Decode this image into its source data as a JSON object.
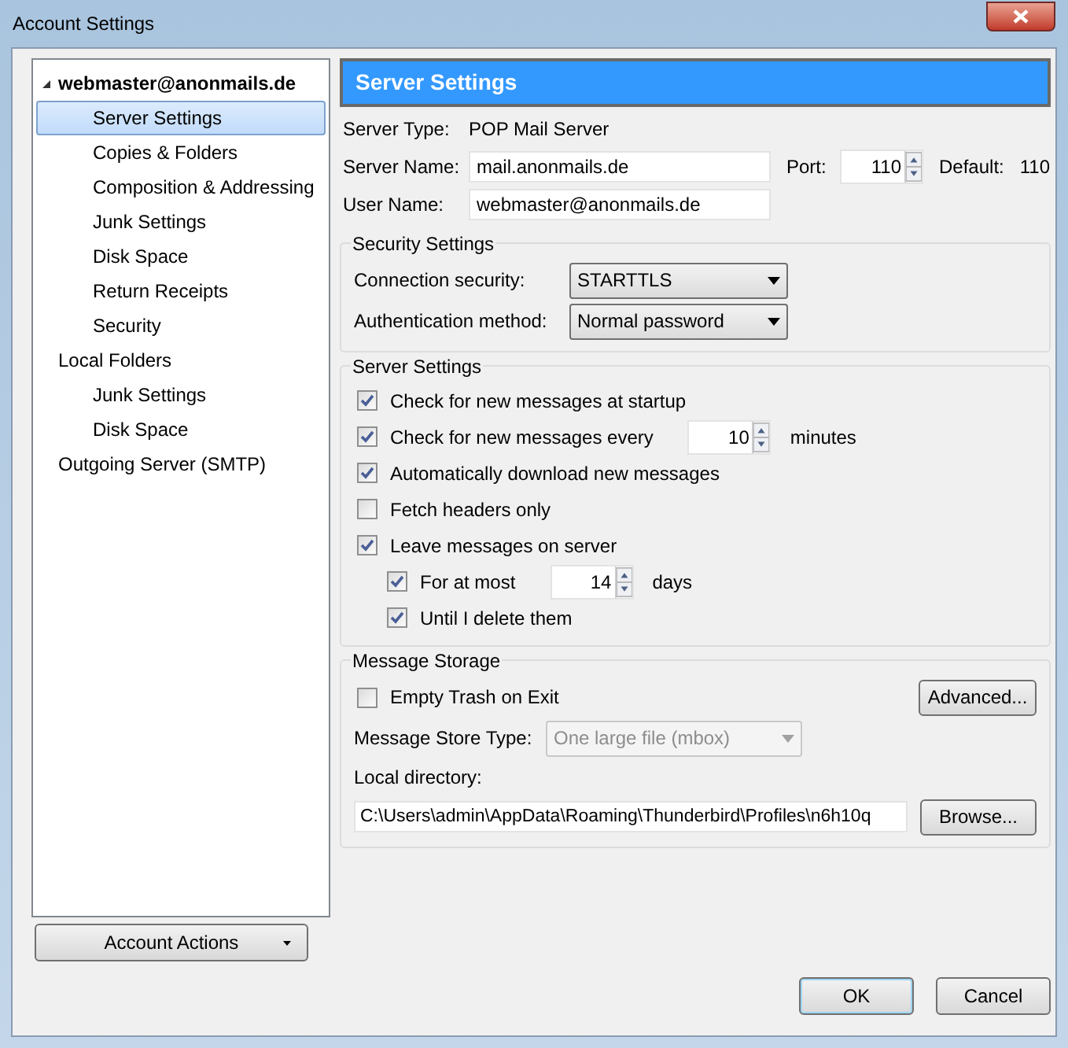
{
  "window": {
    "title": "Account Settings"
  },
  "tree": [
    {
      "label": "webmaster@anonmails.de",
      "selected": false,
      "expanded": true,
      "children": [
        {
          "label": "Server Settings",
          "selected": true
        },
        {
          "label": "Copies & Folders",
          "selected": false
        },
        {
          "label": "Composition & Addressing",
          "selected": false
        },
        {
          "label": "Junk Settings",
          "selected": false
        },
        {
          "label": "Disk Space",
          "selected": false
        },
        {
          "label": "Return Receipts",
          "selected": false
        },
        {
          "label": "Security",
          "selected": false
        }
      ]
    },
    {
      "label": "Local Folders",
      "selected": false,
      "children": [
        {
          "label": "Junk Settings",
          "selected": false
        },
        {
          "label": "Disk Space",
          "selected": false
        }
      ]
    },
    {
      "label": "Outgoing Server (SMTP)",
      "selected": false
    }
  ],
  "account_actions": "Account Actions",
  "header": "Server Settings",
  "server_type": {
    "label": "Server Type:",
    "value": "POP Mail Server"
  },
  "server_name": {
    "label": "Server Name:",
    "value": "mail.anonmails.de"
  },
  "port": {
    "label": "Port:",
    "value": "110"
  },
  "default_port": {
    "label": "Default:",
    "value": "110"
  },
  "user_name": {
    "label": "User Name:",
    "value": "webmaster@anonmails.de"
  },
  "security": {
    "title": "Security Settings",
    "rows": [
      {
        "label": "Connection security:",
        "value": "STARTTLS"
      },
      {
        "label": "Authentication method:",
        "value": "Normal password"
      }
    ]
  },
  "server_settings": {
    "title": "Server Settings",
    "items": [
      {
        "label": "Check for new messages at startup",
        "checked": true
      },
      {
        "label": "Check for new messages every",
        "checked": true,
        "spin": "10",
        "suffix": "minutes"
      },
      {
        "label": "Automatically download new messages",
        "checked": true
      },
      {
        "label": "Fetch headers only",
        "checked": false
      },
      {
        "label": "Leave messages on server",
        "checked": true,
        "children": [
          {
            "label": "For at most",
            "checked": true,
            "spin": "14",
            "suffix": "days"
          },
          {
            "label": "Until I delete them",
            "checked": true
          }
        ]
      }
    ]
  },
  "storage": {
    "title": "Message Storage",
    "empty_trash": {
      "label": "Empty Trash on Exit",
      "checked": false
    },
    "advanced": "Advanced...",
    "store_type": {
      "label": "Message Store Type:",
      "value": "One large file (mbox)",
      "disabled": true
    },
    "local_dir_label": "Local directory:",
    "local_dir": "C:\\Users\\admin\\AppData\\Roaming\\Thunderbird\\Profiles\\n6h10q",
    "browse": "Browse..."
  },
  "buttons": [
    {
      "label": "OK",
      "default": true
    },
    {
      "label": "Cancel",
      "default": false
    }
  ]
}
